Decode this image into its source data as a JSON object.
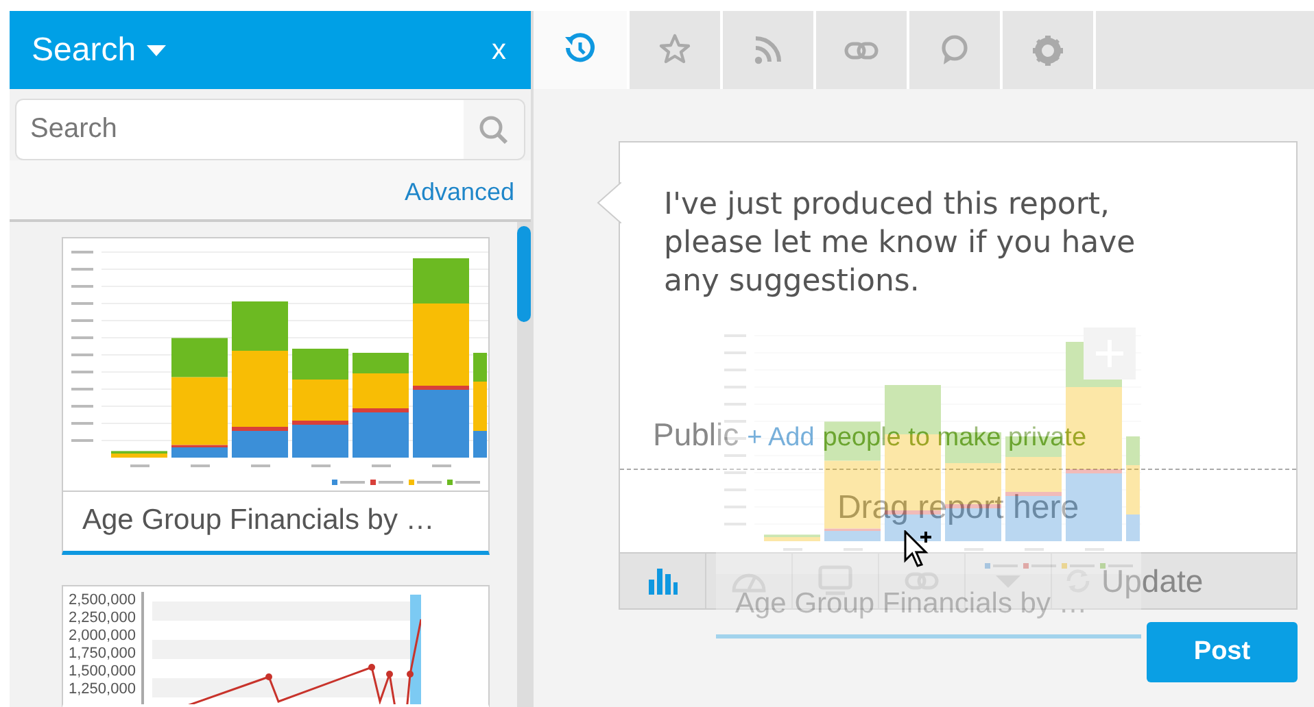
{
  "sidebar": {
    "title": "Search",
    "close": "x",
    "search": {
      "placeholder": "Search"
    },
    "advanced": "Advanced",
    "results": [
      {
        "kind": "bar",
        "title": "Age Group Financials by …",
        "selected": true
      },
      {
        "kind": "line",
        "axis_labels": [
          "2,500,000",
          "2,250,000",
          "2,000,000",
          "1,750,000",
          "1,500,000",
          "1,250,000"
        ],
        "selected": false
      }
    ]
  },
  "tabs": [
    {
      "kind": "history",
      "selected": true
    },
    {
      "kind": "star",
      "selected": false
    },
    {
      "kind": "rss",
      "selected": false
    },
    {
      "kind": "link",
      "selected": false
    },
    {
      "kind": "comment",
      "selected": false
    },
    {
      "kind": "gear",
      "selected": false
    }
  ],
  "composer": {
    "message": "I've just produced this report, please let me know if you have any suggestions.",
    "visibility": "Public",
    "add_people": "+ Add",
    "add_people_rest": "people to make private",
    "drop_hint": "Drag report here",
    "toolbar": [
      {
        "kind": "bar-chart",
        "selected": true
      },
      {
        "kind": "gauge",
        "selected": false
      },
      {
        "kind": "monitor",
        "selected": false
      },
      {
        "kind": "link",
        "selected": false
      },
      {
        "kind": "caret",
        "selected": false
      }
    ],
    "update": "Update",
    "post": "Post"
  },
  "drag_preview": {
    "title": "Age Group Financials by …"
  }
}
